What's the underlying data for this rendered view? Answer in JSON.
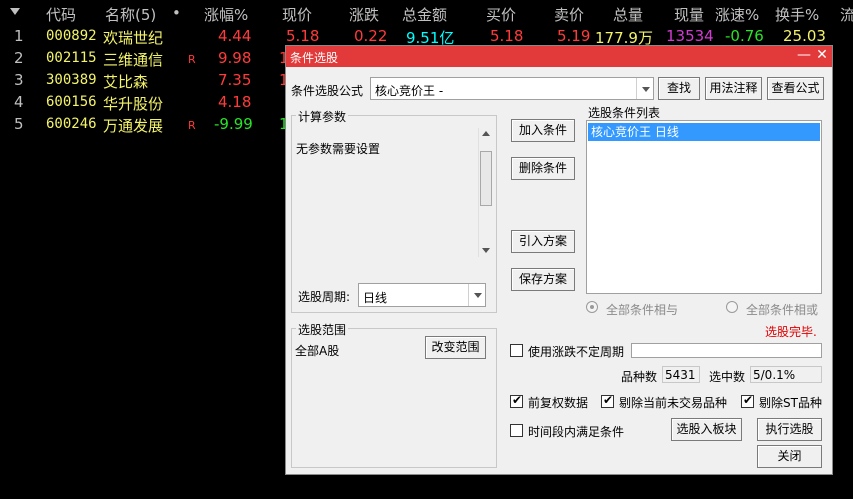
{
  "grid": {
    "headers": [
      "代码",
      "名称(5)",
      "•",
      "涨幅%",
      "现价",
      "涨跌",
      "总金额",
      "买价",
      "卖价",
      "总量",
      "现量",
      "涨速%",
      "换手%",
      "流"
    ],
    "rows": [
      {
        "idx": "1",
        "code": "000892",
        "name": "欢瑞世纪",
        "r": "",
        "change_pct": "4.44",
        "price": "5.18",
        "diff": "0.22",
        "amount": "9.51亿",
        "bid": "5.18",
        "ask": "5.19",
        "volume": "177.9万",
        "cur_vol": "13534",
        "speed": "-0.76",
        "turnover": "25.03"
      },
      {
        "idx": "2",
        "code": "002115",
        "name": "三维通信",
        "r": "R",
        "change_pct": "9.98",
        "price": "1"
      },
      {
        "idx": "3",
        "code": "300389",
        "name": "艾比森",
        "r": "",
        "change_pct": "7.35",
        "price": "1"
      },
      {
        "idx": "4",
        "code": "600156",
        "name": "华升股份",
        "r": "",
        "change_pct": "4.18",
        "price": ""
      },
      {
        "idx": "5",
        "code": "600246",
        "name": "万通发展",
        "r": "R",
        "change_pct": "-9.99",
        "price": "1"
      }
    ]
  },
  "dialog": {
    "title": "条件选股",
    "formula_label": "条件选股公式",
    "formula_value": "核心竞价王  -",
    "find_btn": "查找",
    "usage_btn": "用法注释",
    "view_formula_btn": "查看公式",
    "params_group": "计算参数",
    "params_text": "无参数需要设置",
    "period_label": "选股周期:",
    "period_value": "日线",
    "add_condition_btn": "加入条件",
    "delete_condition_btn": "删除条件",
    "import_scheme_btn": "引入方案",
    "save_scheme_btn": "保存方案",
    "conditions_list_label": "选股条件列表",
    "conditions": [
      "核心竞价王  日线"
    ],
    "radio_and": "全部条件相与",
    "radio_or": "全部条件相或",
    "status": "选股完毕.",
    "range_group": "选股范围",
    "range_value": "全部A股",
    "change_range_btn": "改变范围",
    "use_period_label": "使用涨跌不定周期",
    "count_label": "品种数",
    "count_value": "5431",
    "selected_label": "选中数",
    "selected_value": "5/0.1%",
    "pre_adjust_label": "前复权数据",
    "exclude_untraded_label": "剔除当前未交易品种",
    "exclude_st_label": "剔除ST品种",
    "time_range_label": "时间段内满足条件",
    "to_board_btn": "选股入板块",
    "execute_btn": "执行选股",
    "close_btn": "关闭"
  }
}
